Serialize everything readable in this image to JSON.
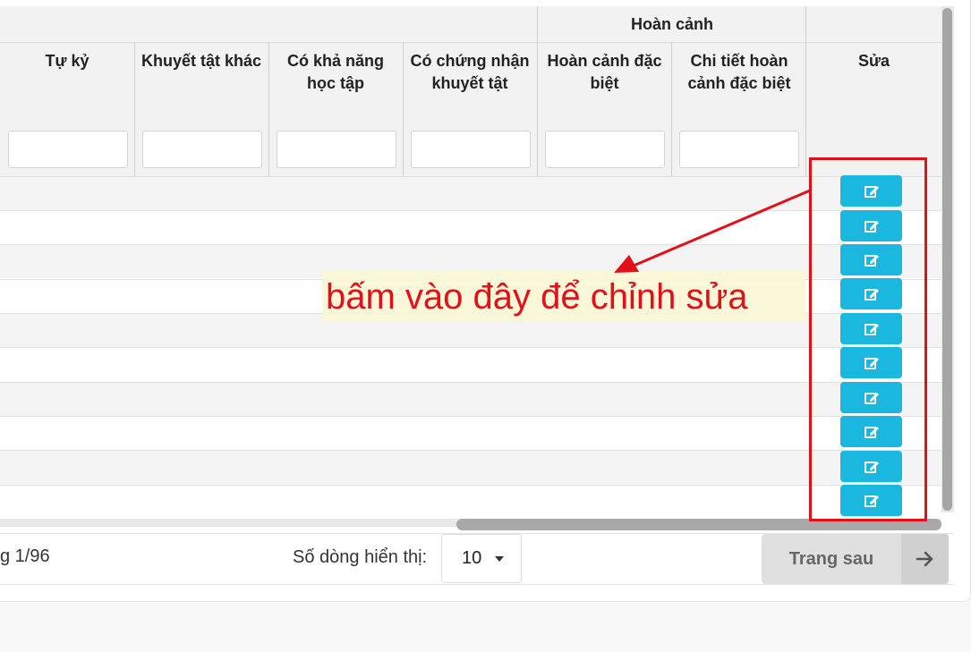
{
  "table": {
    "group_header": "Hoàn cảnh",
    "columns": [
      {
        "label": "Tự kỷ"
      },
      {
        "label": "Khuyết tật khác"
      },
      {
        "label": "Có khả năng học tập"
      },
      {
        "label": "Có chứng nhận khuyết tật"
      },
      {
        "label": "Hoàn cảnh đặc biệt"
      },
      {
        "label": "Chi tiết hoàn cảnh đặc biệt"
      },
      {
        "label": "Sửa"
      }
    ],
    "row_count": 10,
    "edit_icon": "edit-icon"
  },
  "pagination": {
    "page_info": "g 1/96",
    "rows_label": "Số dòng hiển thị:",
    "rows_value": "10",
    "next_label": "Trang sau",
    "next_icon": "arrow-right-icon"
  },
  "annotation": {
    "callout": "bấm vào đây để chỉnh sửa",
    "color": "#e3101a"
  },
  "colors": {
    "edit_button": "#1ab8de",
    "header_bg": "#f2f2f2"
  }
}
